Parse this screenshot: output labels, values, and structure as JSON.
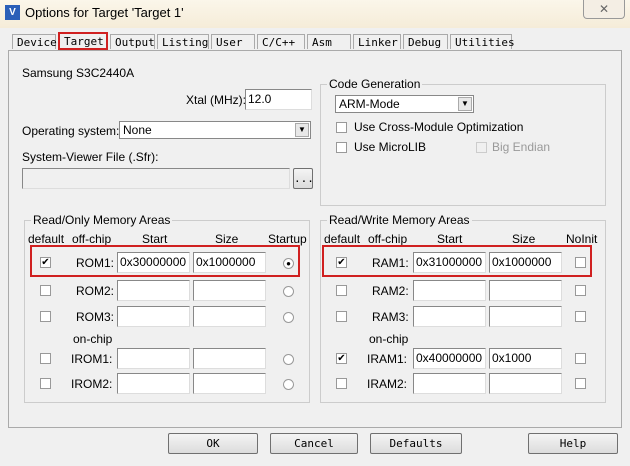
{
  "window": {
    "title": "Options for Target 'Target 1'",
    "close": "✕"
  },
  "tabs": [
    "Device",
    "Target",
    "Output",
    "Listing",
    "User",
    "C/C++",
    "Asm",
    "Linker",
    "Debug",
    "Utilities"
  ],
  "device": "Samsung S3C2440A",
  "xtal": {
    "label": "Xtal (MHz):",
    "value": "12.0"
  },
  "os": {
    "label": "Operating system:",
    "value": "None"
  },
  "sfr": {
    "label": "System-Viewer File (.Sfr):",
    "value": "",
    "browse": "..."
  },
  "codegen": {
    "title": "Code Generation",
    "mode": "ARM-Mode",
    "cross": "Use Cross-Module Optimization",
    "microlib": "Use MicroLIB",
    "bigendian": "Big Endian"
  },
  "rom": {
    "title": "Read/Only Memory Areas",
    "h_default": "default",
    "h_offchip": "off-chip",
    "h_start": "Start",
    "h_size": "Size",
    "h_startup": "Startup",
    "onchip": "on-chip",
    "rows": [
      {
        "name": "ROM1:",
        "start": "0x30000000",
        "size": "0x1000000",
        "checked": true,
        "startup": true
      },
      {
        "name": "ROM2:",
        "start": "",
        "size": "",
        "checked": false,
        "startup": false
      },
      {
        "name": "ROM3:",
        "start": "",
        "size": "",
        "checked": false,
        "startup": false
      },
      {
        "name": "IROM1:",
        "start": "",
        "size": "",
        "checked": false,
        "startup": false
      },
      {
        "name": "IROM2:",
        "start": "",
        "size": "",
        "checked": false,
        "startup": false
      }
    ]
  },
  "ram": {
    "title": "Read/Write Memory Areas",
    "h_default": "default",
    "h_offchip": "off-chip",
    "h_start": "Start",
    "h_size": "Size",
    "h_noinit": "NoInit",
    "onchip": "on-chip",
    "rows": [
      {
        "name": "RAM1:",
        "start": "0x31000000",
        "size": "0x1000000",
        "checked": true
      },
      {
        "name": "RAM2:",
        "start": "",
        "size": "",
        "checked": false
      },
      {
        "name": "RAM3:",
        "start": "",
        "size": "",
        "checked": false
      },
      {
        "name": "IRAM1:",
        "start": "0x40000000",
        "size": "0x1000",
        "checked": true
      },
      {
        "name": "IRAM2:",
        "start": "",
        "size": "",
        "checked": false
      }
    ]
  },
  "buttons": {
    "ok": "OK",
    "cancel": "Cancel",
    "defaults": "Defaults",
    "help": "Help"
  }
}
